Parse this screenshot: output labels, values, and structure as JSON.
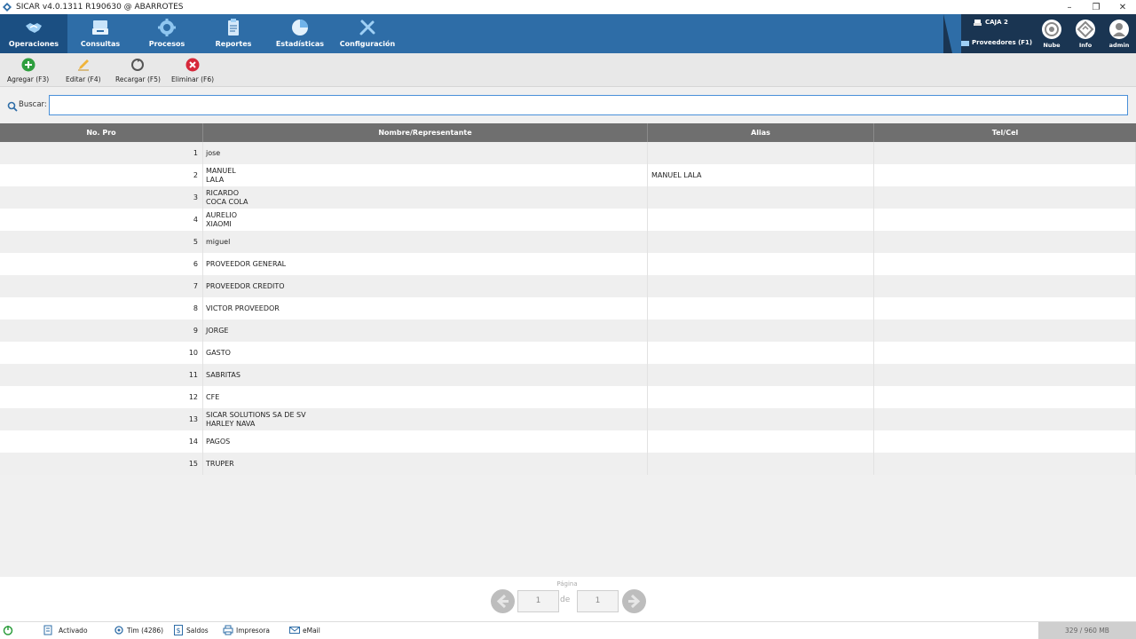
{
  "window": {
    "title": "SICAR v4.0.1311 R190630 @ ABARROTES"
  },
  "nav": {
    "items": [
      {
        "label": "Operaciones",
        "icon": "handshake-icon"
      },
      {
        "label": "Consultas",
        "icon": "register-icon"
      },
      {
        "label": "Procesos",
        "icon": "gear-icon"
      },
      {
        "label": "Reportes",
        "icon": "clipboard-icon"
      },
      {
        "label": "Estadísticas",
        "icon": "pie-chart-icon"
      },
      {
        "label": "Configuración",
        "icon": "tools-icon"
      }
    ],
    "caja": "CAJA 2",
    "section": "Proveedores (F1)",
    "right": [
      {
        "label": "Nube",
        "icon": "cloud-icon"
      },
      {
        "label": "Info",
        "icon": "info-icon"
      },
      {
        "label": "admin",
        "icon": "user-icon"
      }
    ]
  },
  "toolbar": {
    "add": "Agregar (F3)",
    "edit": "Editar (F4)",
    "reload": "Recargar (F5)",
    "delete": "Eliminar (F6)"
  },
  "search": {
    "label": "Buscar:",
    "value": ""
  },
  "table": {
    "headers": [
      "No. Pro",
      "Nombre/Representante",
      "Alias",
      "Tel/Cel"
    ],
    "rows": [
      {
        "num": "1",
        "name": "jose",
        "rep": "",
        "alias": "",
        "tel": ""
      },
      {
        "num": "2",
        "name": "MANUEL",
        "rep": "LALA",
        "alias": "MANUEL LALA",
        "tel": ""
      },
      {
        "num": "3",
        "name": "RICARDO",
        "rep": "COCA COLA",
        "alias": "",
        "tel": ""
      },
      {
        "num": "4",
        "name": "AURELIO",
        "rep": "XIAOMI",
        "alias": "",
        "tel": ""
      },
      {
        "num": "5",
        "name": "miguel",
        "rep": "",
        "alias": "",
        "tel": ""
      },
      {
        "num": "6",
        "name": "PROVEEDOR GENERAL",
        "rep": "",
        "alias": "",
        "tel": ""
      },
      {
        "num": "7",
        "name": "PROVEEDOR CREDITO",
        "rep": "",
        "alias": "",
        "tel": ""
      },
      {
        "num": "8",
        "name": "VICTOR PROVEEDOR",
        "rep": "",
        "alias": "",
        "tel": ""
      },
      {
        "num": "9",
        "name": "JORGE",
        "rep": "",
        "alias": "",
        "tel": ""
      },
      {
        "num": "10",
        "name": "GASTO",
        "rep": "",
        "alias": "",
        "tel": ""
      },
      {
        "num": "11",
        "name": "SABRITAS",
        "rep": "",
        "alias": "",
        "tel": ""
      },
      {
        "num": "12",
        "name": "CFE",
        "rep": "",
        "alias": "",
        "tel": ""
      },
      {
        "num": "13",
        "name": "SICAR SOLUTIONS SA DE SV",
        "rep": "HARLEY NAVA",
        "alias": "",
        "tel": ""
      },
      {
        "num": "14",
        "name": "PAGOS",
        "rep": "",
        "alias": "",
        "tel": ""
      },
      {
        "num": "15",
        "name": "TRUPER",
        "rep": "",
        "alias": "",
        "tel": ""
      }
    ]
  },
  "pager": {
    "label": "Página",
    "page": "1",
    "of_label": "de",
    "total": "1"
  },
  "status": {
    "activado": "Activado",
    "timbres": "Tim (4286)",
    "saldos": "Saldos",
    "impresora": "Impresora",
    "email": "eMail",
    "memory": "329 / 960 MB"
  },
  "colors": {
    "nav": "#2e6da7",
    "nav_active": "#1b4f82",
    "header": "#6f6f6f",
    "add": "#2e9e3e",
    "delete": "#d6283a"
  }
}
